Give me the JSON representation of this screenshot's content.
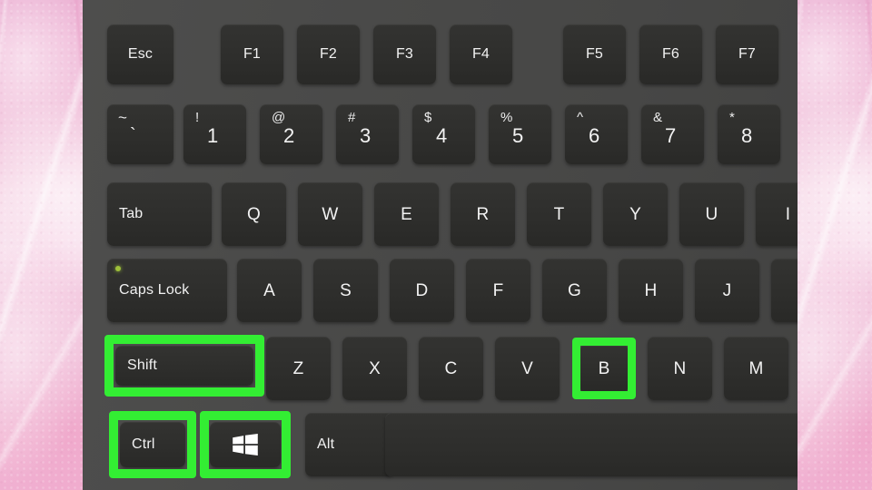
{
  "image": {
    "title": "Windows keyboard shortcut illustration",
    "description": "Close-up photo of a dark laptop keyboard with green highlight boxes drawn around the Ctrl, Windows, Shift and B keys, on a pink marble background",
    "background_color": "#f0bcd8",
    "keyboard_body_color": "#4a4a49",
    "key_color": "#2e2e2c",
    "key_label_color": "#f2f2f2",
    "highlight_color": "#33ee33",
    "caps_lock_led_color": "#9ec03a"
  },
  "shortcut": {
    "keys": [
      "Ctrl",
      "Windows",
      "Shift",
      "B"
    ],
    "highlighted_key_names": [
      "shift-key",
      "ctrl-key",
      "windows-key",
      "b-key"
    ]
  },
  "keyboard": {
    "rows": [
      {
        "name": "function-row",
        "keys": [
          {
            "name": "esc-key",
            "label": "Esc",
            "style": "fn"
          },
          {
            "name": "f1-key",
            "label": "F1",
            "style": "fn"
          },
          {
            "name": "f2-key",
            "label": "F2",
            "style": "fn"
          },
          {
            "name": "f3-key",
            "label": "F3",
            "style": "fn"
          },
          {
            "name": "f4-key",
            "label": "F4",
            "style": "fn"
          },
          {
            "name": "f5-key",
            "label": "F5",
            "style": "fn"
          },
          {
            "name": "f6-key",
            "label": "F6",
            "style": "fn"
          },
          {
            "name": "f7-key",
            "label": "F7",
            "style": "fn"
          }
        ]
      },
      {
        "name": "number-row",
        "keys": [
          {
            "name": "backtick-key",
            "symbol": "~",
            "digit": "`"
          },
          {
            "name": "one-key",
            "symbol": "!",
            "digit": "1"
          },
          {
            "name": "two-key",
            "symbol": "@",
            "digit": "2"
          },
          {
            "name": "three-key",
            "symbol": "#",
            "digit": "3"
          },
          {
            "name": "four-key",
            "symbol": "$",
            "digit": "4"
          },
          {
            "name": "five-key",
            "symbol": "%",
            "digit": "5"
          },
          {
            "name": "six-key",
            "symbol": "^",
            "digit": "6"
          },
          {
            "name": "seven-key",
            "symbol": "&",
            "digit": "7"
          },
          {
            "name": "eight-key",
            "symbol": "*",
            "digit": "8"
          }
        ]
      },
      {
        "name": "qwerty-row",
        "keys": [
          {
            "name": "tab-key",
            "label": "Tab",
            "align": "left"
          },
          {
            "name": "q-key",
            "label": "Q"
          },
          {
            "name": "w-key",
            "label": "W"
          },
          {
            "name": "e-key",
            "label": "E"
          },
          {
            "name": "r-key",
            "label": "R"
          },
          {
            "name": "t-key",
            "label": "T"
          },
          {
            "name": "y-key",
            "label": "Y"
          },
          {
            "name": "u-key",
            "label": "U"
          },
          {
            "name": "i-key",
            "label": "I"
          }
        ]
      },
      {
        "name": "home-row",
        "keys": [
          {
            "name": "caps-lock-key",
            "label": "Caps Lock",
            "align": "left",
            "led": true
          },
          {
            "name": "a-key",
            "label": "A"
          },
          {
            "name": "s-key",
            "label": "S"
          },
          {
            "name": "d-key",
            "label": "D"
          },
          {
            "name": "f-key",
            "label": "F"
          },
          {
            "name": "g-key",
            "label": "G"
          },
          {
            "name": "h-key",
            "label": "H"
          },
          {
            "name": "j-key",
            "label": "J"
          },
          {
            "name": "k-key",
            "label": ""
          }
        ]
      },
      {
        "name": "zxcv-row",
        "keys": [
          {
            "name": "shift-key",
            "label": "Shift",
            "align": "left",
            "highlighted": true
          },
          {
            "name": "z-key",
            "label": "Z"
          },
          {
            "name": "x-key",
            "label": "X"
          },
          {
            "name": "c-key",
            "label": "C"
          },
          {
            "name": "v-key",
            "label": "V"
          },
          {
            "name": "b-key",
            "label": "B",
            "highlighted": true
          },
          {
            "name": "n-key",
            "label": "N"
          },
          {
            "name": "m-key",
            "label": "M"
          },
          {
            "name": "comma-key",
            "label": ""
          }
        ]
      },
      {
        "name": "bottom-row",
        "keys": [
          {
            "name": "ctrl-key",
            "label": "Ctrl",
            "align": "left",
            "highlighted": true
          },
          {
            "name": "windows-key",
            "label": "",
            "icon": "windows-logo-icon",
            "highlighted": true
          },
          {
            "name": "alt-key",
            "label": "Alt",
            "align": "left"
          },
          {
            "name": "space-key",
            "label": ""
          }
        ]
      }
    ]
  }
}
